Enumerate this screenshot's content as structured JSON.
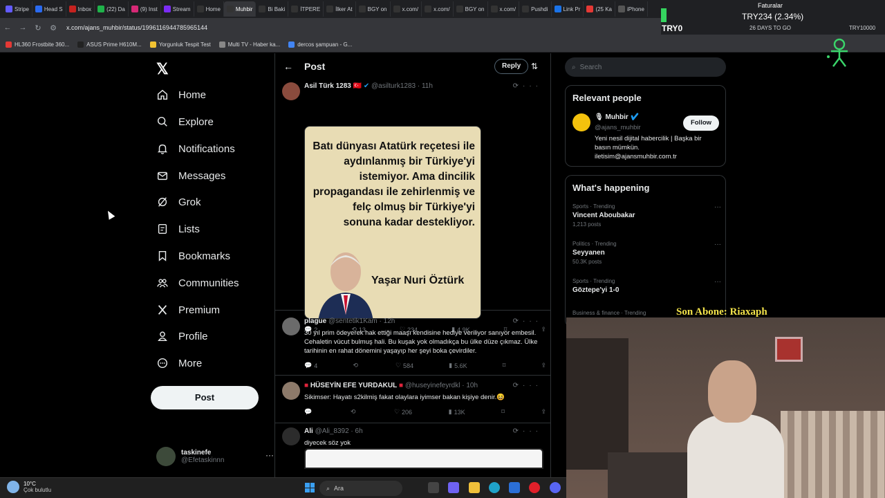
{
  "browser": {
    "tabs": [
      {
        "label": "Stripe",
        "color": "#635bff",
        "active": false
      },
      {
        "label": "Head S",
        "color": "#2a6af0",
        "active": false
      },
      {
        "label": "Inbox",
        "color": "#c5221f",
        "active": false
      },
      {
        "label": "(22) Da",
        "color": "#1fb24a",
        "active": false
      },
      {
        "label": "(9) Inst",
        "color": "#d62976",
        "active": false
      },
      {
        "label": "Stream",
        "color": "#7b2cf5",
        "active": false
      },
      {
        "label": "Home",
        "color": "#333333",
        "active": false
      },
      {
        "label": "Muhbir",
        "color": "#333333",
        "active": true
      },
      {
        "label": "Bi Baki",
        "color": "#333333",
        "active": false
      },
      {
        "label": "İTPERE",
        "color": "#333333",
        "active": false
      },
      {
        "label": "İlker At",
        "color": "#333333",
        "active": false
      },
      {
        "label": "BGY on",
        "color": "#333333",
        "active": false
      },
      {
        "label": "x.com/",
        "color": "#333333",
        "active": false
      },
      {
        "label": "x.com/",
        "color": "#333333",
        "active": false
      },
      {
        "label": "BGY on",
        "color": "#333333",
        "active": false
      },
      {
        "label": "x.com/",
        "color": "#333333",
        "active": false
      },
      {
        "label": "Pushdi",
        "color": "#333333",
        "active": false
      },
      {
        "label": "Link Pr",
        "color": "#1a73e8",
        "active": false
      },
      {
        "label": "(25 Ka",
        "color": "#e53935",
        "active": false
      },
      {
        "label": "iPhone",
        "color": "#555555",
        "active": false
      }
    ],
    "url": "x.com/ajans_muhbir/status/1996116944785965144",
    "bookmarks": [
      {
        "label": "HL360 Frostbite 360...",
        "color": "#e53935"
      },
      {
        "label": "ASUS Prime H610M...",
        "color": "#222222"
      },
      {
        "label": "Yorgunluk Tespit Test",
        "color": "#f1c232"
      },
      {
        "label": "Multi TV - Haber ka...",
        "color": "#888888"
      },
      {
        "label": "dercos şampuan - G...",
        "color": "#4285f4"
      }
    ]
  },
  "ticker": {
    "value": "TRY234 (2.34%)",
    "symbol": "TRY0",
    "days_to_go": "26 DAYS TO GO",
    "top_label": "Faturalar",
    "right_label": "TRY10000"
  },
  "twitter": {
    "nav": [
      {
        "label": "Home",
        "icon": "home-icon"
      },
      {
        "label": "Explore",
        "icon": "search-icon"
      },
      {
        "label": "Notifications",
        "icon": "bell-icon"
      },
      {
        "label": "Messages",
        "icon": "envelope-icon"
      },
      {
        "label": "Grok",
        "icon": "grok-icon"
      },
      {
        "label": "Lists",
        "icon": "list-icon"
      },
      {
        "label": "Bookmarks",
        "icon": "bookmark-icon"
      },
      {
        "label": "Communities",
        "icon": "communities-icon"
      },
      {
        "label": "Premium",
        "icon": "x-icon"
      },
      {
        "label": "Profile",
        "icon": "person-icon"
      },
      {
        "label": "More",
        "icon": "more-circle-icon"
      }
    ],
    "post_button": "Post",
    "account": {
      "name": "taskinefe",
      "handle": "@Efetaskinnn",
      "more": "···"
    },
    "header": {
      "back": "←",
      "title": "Post",
      "reply_button": "Reply",
      "filter": "⇅"
    },
    "tweets": [
      {
        "name": "Asil Türk 1283",
        "flag": "🇹🇷",
        "handle": "@asilturk1283",
        "time": "· 11h",
        "text": "",
        "image": {
          "quote": "Batı dünyası Atatürk reçetesi ile aydınlanmış bir Türkiye'yi istemiyor. Ama dincilik propagandası ile zehirlenmiş ve felç olmuş bir Türkiye'yi sonuna kadar destekliyor.",
          "signature": "Yaşar Nuri Öztürk"
        },
        "replies": "2",
        "retweets": "13",
        "likes": "234",
        "views": "4.9K"
      },
      {
        "name": "plague",
        "handle": "@sentetik1Kam",
        "time": "· 12h",
        "text": "30 yıl prim ödeyerek hak ettiği maaşı kendisine hediye veriliyor sanıyor embesil. Cehaletin vücut bulmuş hali. Bu kuşak yok olmadıkça bu ülke düze çıkmaz. Ülke tarihinin en rahat dönemini yaşayıp her şeyi boka çevirdiler.",
        "replies": "4",
        "retweets": "",
        "likes": "584",
        "views": "5.6K"
      },
      {
        "name": "HÜSEYİN EFE YURDAKUL",
        "handle": "@huseyinefeyrdkl",
        "time": "· 10h",
        "text": "Sikimser: Hayatı s2kilmiş fakat olaylara iyimser bakan kişiye denir.😆",
        "replies": "",
        "retweets": "",
        "likes": "206",
        "views": "13K"
      },
      {
        "name": "Ali",
        "handle": "@Ali_8392",
        "time": "· 6h",
        "text": "diyecek söz yok"
      }
    ],
    "search_placeholder": "Search",
    "relevant_people": {
      "title": "Relevant people",
      "name": "Muhbir",
      "handle": "@ajans_muhbir",
      "follow": "Follow",
      "bio": "Yeni nesil dijital habercilik | Başka bir basın mümkün. iletisim@ajansmuhbir.com.tr"
    },
    "whats_happening": {
      "title": "What's happening",
      "trends": [
        {
          "category": "Sports · Trending",
          "title": "Vincent Aboubakar",
          "count": "1,213 posts"
        },
        {
          "category": "Politics · Trending",
          "title": "Seyyanen",
          "count": "50.3K posts"
        },
        {
          "category": "Sports · Trending",
          "title": "Göztepe'yi 1-0",
          "count": ""
        },
        {
          "category": "Business & finance · Trending",
          "title": "",
          "count": ""
        }
      ]
    }
  },
  "stream": {
    "subscriber": "Son Abone: Riaxaph"
  },
  "taskbar": {
    "temp": "10°C",
    "weather": "Çok bulutlu",
    "search": "Ara"
  }
}
